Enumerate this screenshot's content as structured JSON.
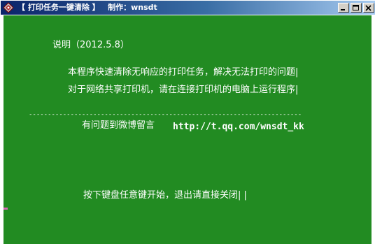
{
  "window": {
    "title": "【 打印任务一键清除 】   制作：wnsdt",
    "icon": "printer-app-icon",
    "buttons": {
      "minimize_icon": "minimize-icon",
      "maximize_icon": "maximize-icon",
      "close_icon": "close-icon"
    }
  },
  "console": {
    "background_color": "#228b22",
    "text_color": "#ffffff",
    "header": "说明（2012.5.8）",
    "line1": "本程序快速清除无响应的打印任务，解决无法打印的问题|",
    "line2": "对于网络共享打印机，请在连接打印机的电脑上运行程序|",
    "separator": "------------------------------------------------------------------------",
    "contact_label": "有问题到微博留言",
    "contact_url": "http://t.qq.com/wnsdt_kk",
    "prompt": "按下键盘任意键开始，退出请直接关闭| |"
  }
}
